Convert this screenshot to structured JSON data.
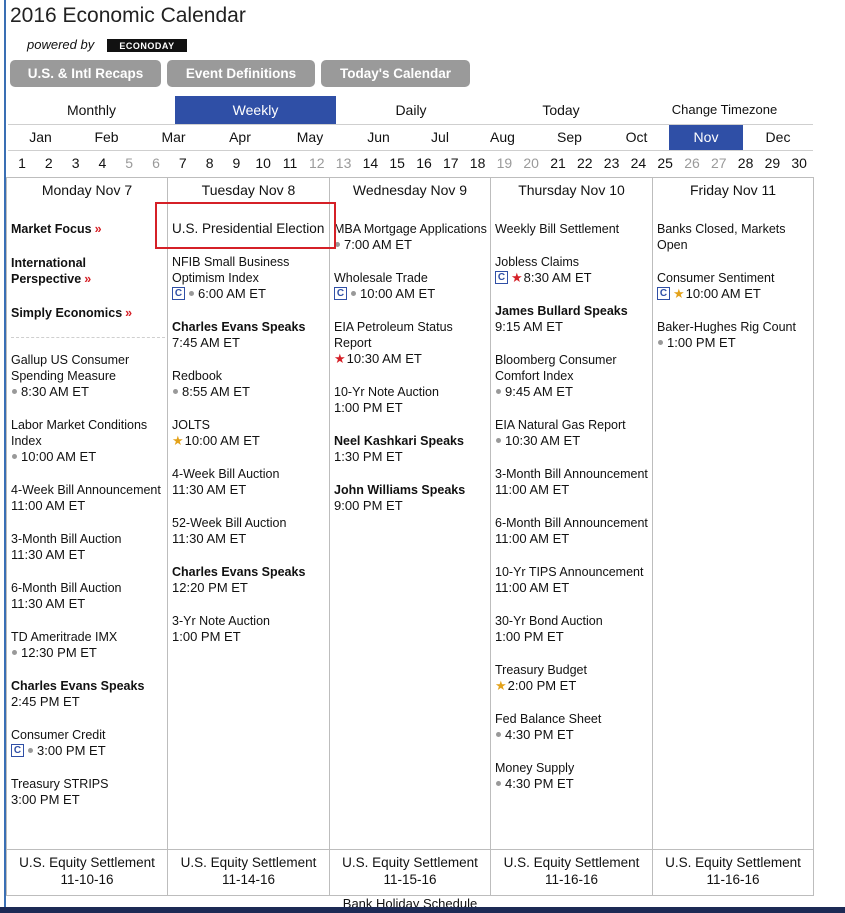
{
  "title": "2016 Economic Calendar",
  "powered_by": "powered by",
  "logo_text": "ECONODAY",
  "top_buttons": [
    "U.S. & Intl Recaps",
    "Event Definitions",
    "Today's Calendar"
  ],
  "nav": {
    "monthly": "Monthly",
    "weekly": "Weekly",
    "daily": "Daily",
    "today": "Today",
    "change_tz": "Change Timezone"
  },
  "months": [
    "Jan",
    "Feb",
    "Mar",
    "Apr",
    "May",
    "Jun",
    "Jul",
    "Aug",
    "Sep",
    "Oct",
    "Nov",
    "Dec"
  ],
  "active_month": "Nov",
  "days": [
    "1",
    "2",
    "3",
    "4",
    "5",
    "6",
    "7",
    "8",
    "9",
    "10",
    "11",
    "12",
    "13",
    "14",
    "15",
    "16",
    "17",
    "18",
    "19",
    "20",
    "21",
    "22",
    "23",
    "24",
    "25",
    "26",
    "27",
    "28",
    "29",
    "30"
  ],
  "columns": [
    {
      "header": "Monday Nov 7",
      "focus_links": [
        "Market Focus",
        "International Perspective",
        "Simply Economics"
      ],
      "events": [
        {
          "name": "Gallup US Consumer Spending Measure",
          "time": "8:30 AM ET",
          "dot": true
        },
        {
          "name": "Labor Market Conditions Index",
          "time": "10:00 AM ET",
          "dot": true
        },
        {
          "name": "4-Week Bill Announcement",
          "time": "11:00 AM ET"
        },
        {
          "name": "3-Month Bill Auction",
          "time": "11:30 AM ET"
        },
        {
          "name": "6-Month Bill Auction",
          "time": "11:30 AM ET"
        },
        {
          "name": "TD Ameritrade IMX",
          "time": "12:30 PM ET",
          "dot": true
        },
        {
          "name": "Charles Evans Speaks",
          "time": "2:45 PM ET",
          "bold": true
        },
        {
          "name": "Consumer Credit",
          "time": "3:00 PM ET",
          "dot": true,
          "c": true
        },
        {
          "name": "Treasury STRIPS",
          "time": "3:00 PM ET"
        }
      ],
      "footer": [
        "U.S. Equity Settlement",
        "11-10-16"
      ]
    },
    {
      "header": "Tuesday Nov 8",
      "events": [
        {
          "name": "U.S. Presidential Election",
          "time": ""
        },
        {
          "name": "NFIB Small Business Optimism Index",
          "time": "6:00 AM ET",
          "dot": true,
          "c": true
        },
        {
          "name": "Charles Evans Speaks",
          "time": "7:45 AM ET",
          "bold": true
        },
        {
          "name": "Redbook",
          "time": "8:55 AM ET",
          "dot": true
        },
        {
          "name": "JOLTS",
          "time": "10:00 AM ET",
          "star": "gold"
        },
        {
          "name": "4-Week Bill Auction",
          "time": "11:30 AM ET"
        },
        {
          "name": "52-Week Bill Auction",
          "time": "11:30 AM ET"
        },
        {
          "name": "Charles Evans Speaks",
          "time": "12:20 PM ET",
          "bold": true
        },
        {
          "name": "3-Yr Note Auction",
          "time": "1:00 PM ET"
        }
      ],
      "footer": [
        "U.S. Equity Settlement",
        "11-14-16"
      ]
    },
    {
      "header": "Wednesday Nov 9",
      "events": [
        {
          "name": "MBA Mortgage Applications",
          "time": "7:00 AM ET",
          "dot": true
        },
        {
          "name": "Wholesale Trade",
          "time": "10:00 AM ET",
          "dot": true,
          "c": true
        },
        {
          "name": "EIA Petroleum Status Report",
          "time": "10:30 AM ET",
          "star": "red"
        },
        {
          "name": "10-Yr Note Auction",
          "time": "1:00 PM ET"
        },
        {
          "name": "Neel Kashkari Speaks",
          "time": "1:30 PM ET",
          "bold": true
        },
        {
          "name": "John Williams Speaks",
          "time": "9:00 PM ET",
          "bold": true
        }
      ],
      "footer": [
        "U.S. Equity Settlement",
        "11-15-16"
      ]
    },
    {
      "header": "Thursday Nov 10",
      "events": [
        {
          "name": "Weekly Bill Settlement",
          "time": ""
        },
        {
          "name": "Jobless Claims",
          "time": "8:30 AM ET",
          "c": true,
          "star": "red"
        },
        {
          "name": "James Bullard Speaks",
          "time": "9:15 AM ET",
          "bold": true
        },
        {
          "name": "Bloomberg Consumer Comfort Index",
          "time": "9:45 AM ET",
          "dot": true
        },
        {
          "name": "EIA Natural Gas Report",
          "time": "10:30 AM ET",
          "dot": true
        },
        {
          "name": "3-Month Bill Announcement",
          "time": "11:00 AM ET"
        },
        {
          "name": "6-Month Bill Announcement",
          "time": "11:00 AM ET"
        },
        {
          "name": "10-Yr TIPS Announcement",
          "time": "11:00 AM ET"
        },
        {
          "name": "30-Yr Bond Auction",
          "time": "1:00 PM ET"
        },
        {
          "name": "Treasury Budget",
          "time": "2:00 PM ET",
          "star": "gold"
        },
        {
          "name": "Fed Balance Sheet",
          "time": "4:30 PM ET",
          "dot": true
        },
        {
          "name": "Money Supply",
          "time": "4:30 PM ET",
          "dot": true
        }
      ],
      "footer": [
        "U.S. Equity Settlement",
        "11-16-16"
      ]
    },
    {
      "header": "Friday Nov 11",
      "events": [
        {
          "name": "Banks Closed, Markets Open",
          "time": ""
        },
        {
          "name": "Consumer Sentiment",
          "time": "10:00 AM ET",
          "c": true,
          "star": "gold"
        },
        {
          "name": "Baker-Hughes Rig Count",
          "time": "1:00 PM ET",
          "dot": true
        }
      ],
      "footer": [
        "U.S. Equity Settlement",
        "11-16-16"
      ]
    }
  ],
  "bank_holiday": "Bank Holiday Schedule",
  "colors": {
    "accent": "#2f4fa6",
    "button_gray": "#9a9a9a",
    "highlight_red": "#d52027",
    "star_gold": "#e3a21a"
  }
}
